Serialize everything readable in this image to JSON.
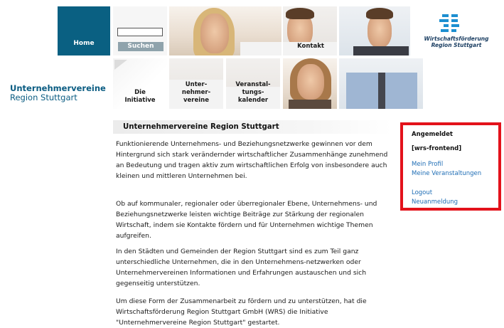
{
  "header": {
    "home_label": "Home",
    "search": {
      "placeholder": "",
      "button_label": "Suchen"
    },
    "nav": {
      "kontakt": "Kontakt",
      "initiative": "Die\nInitiative",
      "unternehmervereine": "Unter-\nnehmer-\nvereine",
      "veranstaltungskalender": "Veranstal-\ntungs-\nkalender"
    },
    "brand": {
      "line1": "Unternehmervereine",
      "line2": "Region Stuttgart"
    },
    "wrs_logo": {
      "line1": "Wirtschaftsförderung",
      "line2": "Region Stuttgart"
    }
  },
  "content": {
    "heading": "Unternehmervereine Region Stuttgart",
    "paragraphs": [
      "Funktionierende Unternehmens- und Beziehungsnetzwerke gewinnen vor dem Hintergrund sich stark verändernder wirtschaftlicher Zusammenhänge zunehmend an Bedeutung und tragen aktiv zum wirtschaftlichen Erfolg von insbesondere auch kleinen und mittleren Unternehmen bei.",
      "Ob auf kommunaler, regionaler oder überregionaler Ebene, Unternehmens- und Beziehungsnetzwerke leisten wichtige Beiträge zur Stärkung der regionalen Wirtschaft, indem sie Kontakte fördern und für Unternehmen wichtige Themen aufgreifen.",
      "In den Städten und Gemeinden der Region Stuttgart sind es zum Teil ganz unterschiedliche Unternehmen, die in den Unternehmens-netzwerken oder Unternehmervereinen Informationen und Erfahrungen austauschen und sich gegenseitig unterstützen.",
      "Um diese Form der Zusammenarbeit zu fördern und zu unterstützen, hat die Wirtschaftsförderung Region Stuttgart GmbH (WRS) die Initiative \"Unternehmervereine Region Stuttgart\" gestartet."
    ]
  },
  "login": {
    "status": "Angemeldet",
    "username": "[wrs-frontend]",
    "links": [
      "Mein Profil",
      "Meine Veranstaltungen",
      "Logout",
      "Neuanmeldung"
    ]
  },
  "colors": {
    "brand_blue": "#0a6082",
    "link_blue": "#1e6db5",
    "highlight_red": "#e3121b"
  }
}
